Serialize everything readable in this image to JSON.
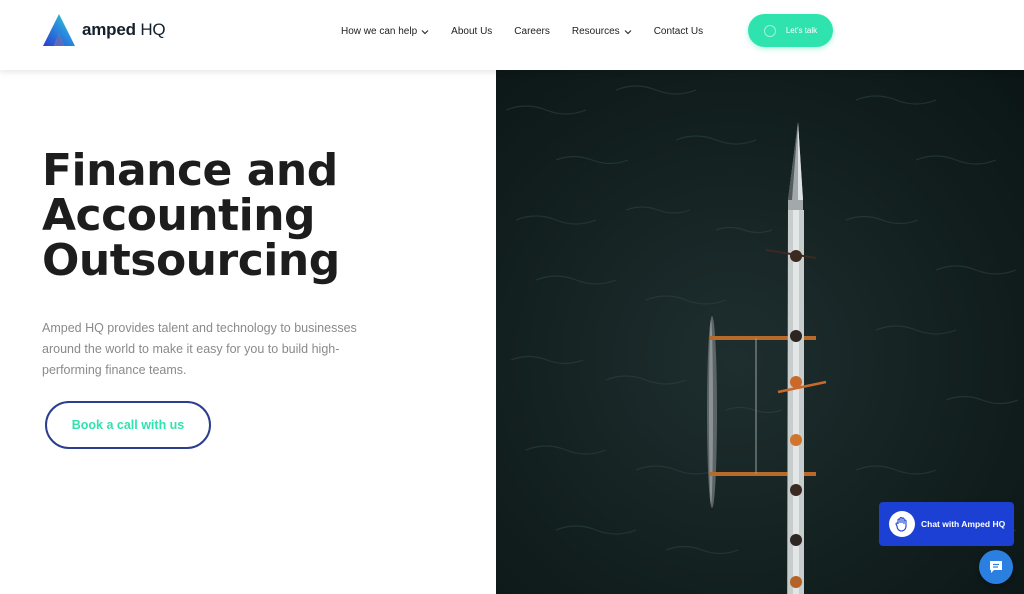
{
  "brand": {
    "name_bold": "amped",
    "name_rest": " HQ",
    "accent": "#2fe3ae",
    "primary": "#1c3fd4",
    "dark_blue": "#2b3e8f"
  },
  "nav": {
    "items": [
      {
        "label": "How we can help",
        "has_dropdown": true
      },
      {
        "label": "About Us",
        "has_dropdown": false
      },
      {
        "label": "Careers",
        "has_dropdown": false
      },
      {
        "label": "Resources",
        "has_dropdown": true
      },
      {
        "label": "Contact Us",
        "has_dropdown": false
      }
    ],
    "cta_label": "Let's talk"
  },
  "hero": {
    "title_lines": [
      "Finance and",
      "Accounting",
      "Outsourcing"
    ],
    "description": "Amped HQ provides talent and technology to businesses around the world to make it easy for you to build high-performing finance teams.",
    "cta_label": "Book a call with us"
  },
  "chat": {
    "label": "Chat with Amped HQ",
    "icon": "wave-hand-icon",
    "launcher_icon": "chat-bubble-icon"
  }
}
